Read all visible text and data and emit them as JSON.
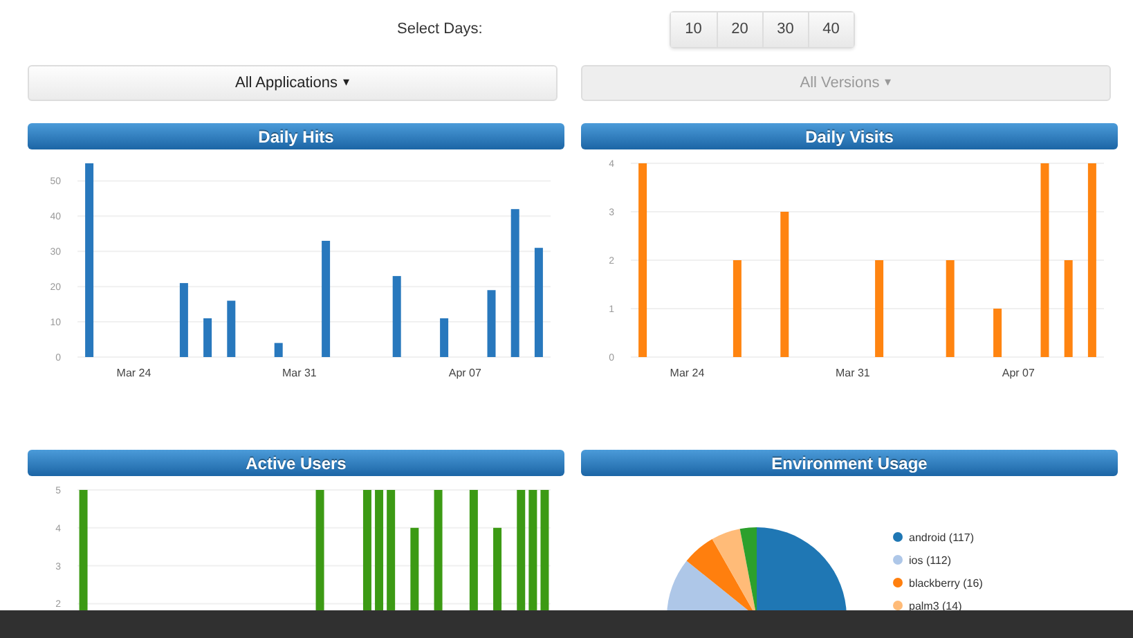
{
  "days_selector": {
    "label": "Select Days:",
    "options": [
      "10",
      "20",
      "30",
      "40"
    ]
  },
  "filters": [
    {
      "label": "All Applications",
      "caret": "▾",
      "disabled": false
    },
    {
      "label": "All Versions",
      "caret": "▾",
      "disabled": true
    }
  ],
  "panels": [
    {
      "chart_data": {
        "type": "bar",
        "title": "Daily Hits",
        "categories": [
          null,
          null,
          "Mar 24",
          null,
          null,
          null,
          null,
          null,
          null,
          "Mar 31",
          null,
          null,
          null,
          null,
          null,
          null,
          "Apr 07",
          null,
          null,
          null
        ],
        "ylim": [
          0,
          55
        ],
        "yticks": [
          0,
          10,
          20,
          30,
          40,
          50
        ],
        "grid": true,
        "series": [
          {
            "color": "#2878bd",
            "values": [
              55,
              0,
              0,
              0,
              21,
              11,
              16,
              0,
              4,
              0,
              33,
              0,
              0,
              23,
              0,
              11,
              0,
              19,
              42,
              31
            ]
          }
        ]
      }
    },
    {
      "chart_data": {
        "type": "bar",
        "title": "Daily Visits",
        "categories": [
          null,
          null,
          "Mar 24",
          null,
          null,
          null,
          null,
          null,
          null,
          "Mar 31",
          null,
          null,
          null,
          null,
          null,
          null,
          "Apr 07",
          null,
          null,
          null
        ],
        "ylim": [
          0,
          4
        ],
        "yticks": [
          0,
          1,
          2,
          3,
          4
        ],
        "grid": true,
        "series": [
          {
            "color": "#ff8410",
            "values": [
              4,
              0,
              0,
              0,
              2,
              0,
              3,
              0,
              0,
              0,
              2,
              0,
              0,
              2,
              0,
              1,
              0,
              4,
              2,
              4
            ]
          }
        ]
      }
    },
    {
      "chart_data": {
        "type": "bar",
        "title": "Active Users",
        "categories": [
          null,
          null,
          null,
          null,
          null,
          null,
          null,
          null,
          null,
          null,
          null,
          null,
          null,
          null,
          null,
          null,
          null,
          null,
          null,
          null,
          null,
          null,
          null,
          null,
          null,
          null,
          null,
          null,
          null,
          null,
          null,
          null,
          null,
          null,
          null,
          null,
          null,
          null,
          null,
          null
        ],
        "ylim": [
          0,
          5
        ],
        "yticks": [
          2,
          3,
          4,
          5
        ],
        "grid": true,
        "series": [
          {
            "color": "#3c9a14",
            "values": [
              5,
              0,
              0,
              0,
              0,
              0,
              0,
              0,
              0,
              0,
              0,
              0,
              0,
              0,
              0,
              0,
              0,
              0,
              0,
              0,
              5,
              0,
              0,
              0,
              5,
              5,
              5,
              0,
              4,
              0,
              5,
              0,
              0,
              5,
              0,
              4,
              0,
              5,
              5,
              5
            ]
          }
        ]
      }
    },
    {
      "chart_data": {
        "type": "pie",
        "title": "Environment Usage",
        "categories": [
          "android (117)",
          "ios (112)",
          "blackberry (16)",
          "palm3 (14)",
          null
        ],
        "values": [
          117,
          112,
          16,
          14,
          8
        ],
        "colors": [
          "#1f77b4",
          "#aec7e8",
          "#ff7f0e",
          "#ffbb78",
          "#2ca02c"
        ],
        "legend": true
      }
    }
  ]
}
